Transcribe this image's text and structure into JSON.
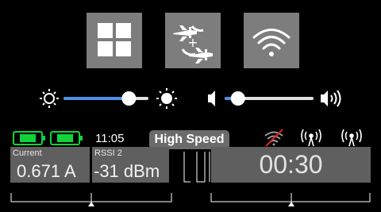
{
  "toolbar": {
    "buttons": [
      {
        "name": "grid-apps",
        "icon": "grid-icon"
      },
      {
        "name": "airplane-transfer",
        "icon": "airplane-transfer-icon"
      },
      {
        "name": "wifi",
        "icon": "wifi-icon"
      }
    ]
  },
  "brightness": {
    "level": 0.77,
    "low_icon": "sun-outline-icon",
    "high_icon": "sun-filled-icon"
  },
  "volume": {
    "level": 0.15,
    "low_icon": "speaker-low-icon",
    "high_icon": "speaker-high-icon"
  },
  "status": {
    "time": "11:05",
    "mode": "High Speed",
    "batteries": [
      {
        "color": "#12d33b"
      },
      {
        "color": "#12d33b"
      }
    ],
    "signal_icons": [
      "wifi-off-icon",
      "antenna-icon",
      "antenna-icon"
    ]
  },
  "telemetry": {
    "current": {
      "caption": "Current",
      "value": "0.671 A"
    },
    "rssi": {
      "caption": "RSSI 2",
      "value": "-31 dBm"
    },
    "timer": "00:30"
  },
  "colors": {
    "accent": "#4f8fe8",
    "battery": "#12d33b",
    "tile": "#7d7d7d",
    "panel": "#5f5f5f",
    "wifi_off_slash": "#e02020"
  }
}
